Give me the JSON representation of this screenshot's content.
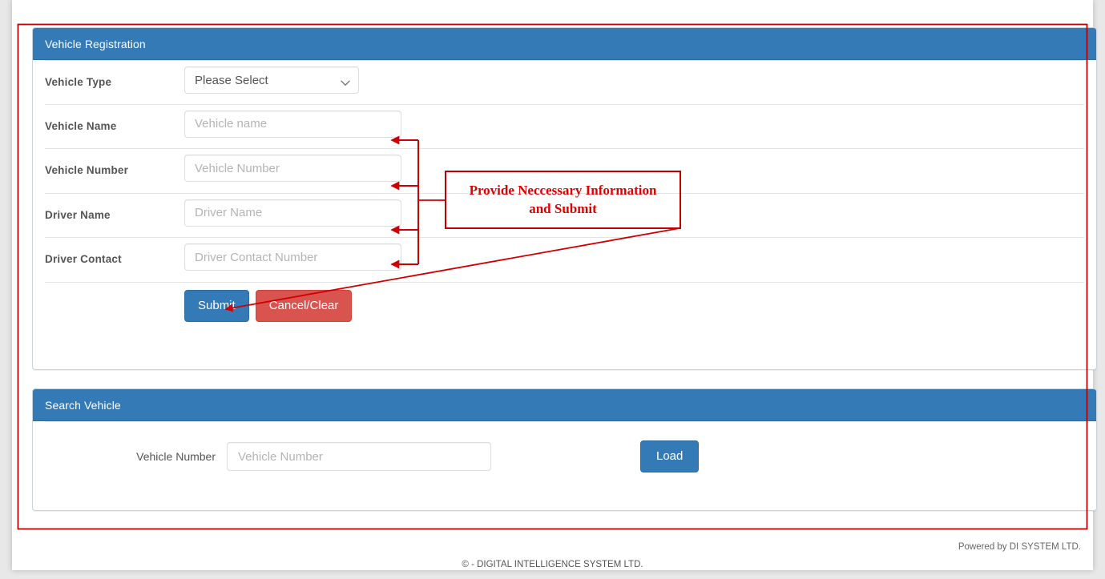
{
  "registration": {
    "title": "Vehicle Registration",
    "rows": [
      {
        "label": "Vehicle Type",
        "control": "select",
        "value": "Please Select",
        "options": [
          "Please Select"
        ],
        "caret_icon": "chevron-down-icon"
      },
      {
        "label": "Vehicle Name",
        "control": "text",
        "value": "",
        "placeholder": "Vehicle name"
      },
      {
        "label": "Vehicle Number",
        "control": "text",
        "value": "",
        "placeholder": "Vehicle Number"
      },
      {
        "label": "Driver Name",
        "control": "text",
        "value": "",
        "placeholder": "Driver Name"
      },
      {
        "label": "Driver Contact",
        "control": "text",
        "value": "",
        "placeholder": "Driver Contact Number"
      }
    ],
    "submit_label": "Submit",
    "cancel_label": "Cancel/Clear"
  },
  "search": {
    "title": "Search Vehicle",
    "field_label": "Vehicle Number",
    "field_value": "",
    "field_placeholder": "Vehicle Number",
    "load_label": "Load"
  },
  "footer": {
    "powered_by": "Powered by DI SYSTEM LTD.",
    "copyright": "©  - DIGITAL INTELLIGENCE SYSTEM LTD."
  },
  "annotation": {
    "callout_text": "Provide Neccessary Information and Submit",
    "callout_line_1": "Provide Neccessary Information",
    "callout_line_2": "and Submit",
    "color": "#e00000",
    "border_color": "#c00000",
    "outer_box_color": "#c00000"
  },
  "colors": {
    "panel_header_blue": "#337ab7",
    "primary_button": "#337ab7",
    "danger_button": "#d9534f",
    "label_text": "#555555",
    "placeholder_text": "#b4b4b4",
    "page_background": "#e8e8e8",
    "sheet_background": "#ffffff"
  }
}
